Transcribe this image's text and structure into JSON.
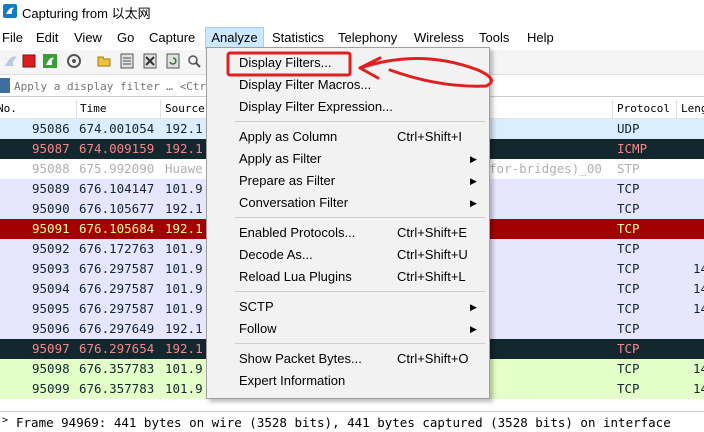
{
  "window": {
    "title": "Capturing from 以太网"
  },
  "menubar": {
    "items": [
      "File",
      "Edit",
      "View",
      "Go",
      "Capture",
      "Analyze",
      "Statistics",
      "Telephony",
      "Wireless",
      "Tools",
      "Help"
    ]
  },
  "filter": {
    "placeholder": "Apply a display filter … <Ctrl-/>"
  },
  "columns": {
    "no": "No.",
    "time": "Time",
    "source": "Source",
    "protocol": "Protocol",
    "length": "Length"
  },
  "packets": [
    {
      "no": "95086",
      "time": "674.001054",
      "src": "192.1",
      "proto": "UDP",
      "len": "",
      "bg": "#daeeff",
      "fg": "#12272e"
    },
    {
      "no": "95087",
      "time": "674.009159",
      "src": "192.1",
      "proto": "ICMP",
      "len": "",
      "bg": "#12272e",
      "fg": "#f78787"
    },
    {
      "no": "95088",
      "time": "675.992090",
      "src": "Huawe",
      "extra": "for-bridges)_00",
      "proto": "STP",
      "len": "",
      "bg": "#ffffff",
      "fg": "#b0b0b0"
    },
    {
      "no": "95089",
      "time": "676.104147",
      "src": "101.9",
      "proto": "TCP",
      "len": "",
      "bg": "#e7e6ff",
      "fg": "#12272e"
    },
    {
      "no": "95090",
      "time": "676.105677",
      "src": "192.1",
      "proto": "TCP",
      "len": "",
      "bg": "#e7e6ff",
      "fg": "#12272e"
    },
    {
      "no": "95091",
      "time": "676.105684",
      "src": "192.1",
      "proto": "TCP",
      "len": "",
      "bg": "#a40000",
      "fg": "#fffc9c"
    },
    {
      "no": "95092",
      "time": "676.172763",
      "src": "101.9",
      "proto": "TCP",
      "len": "",
      "bg": "#e7e6ff",
      "fg": "#12272e"
    },
    {
      "no": "95093",
      "time": "676.297587",
      "src": "101.9",
      "proto": "TCP",
      "len": "14",
      "bg": "#e7e6ff",
      "fg": "#12272e"
    },
    {
      "no": "95094",
      "time": "676.297587",
      "src": "101.9",
      "proto": "TCP",
      "len": "14",
      "bg": "#e7e6ff",
      "fg": "#12272e"
    },
    {
      "no": "95095",
      "time": "676.297587",
      "src": "101.9",
      "proto": "TCP",
      "len": "14",
      "bg": "#e7e6ff",
      "fg": "#12272e"
    },
    {
      "no": "95096",
      "time": "676.297649",
      "src": "192.1",
      "proto": "TCP",
      "len": "",
      "bg": "#e7e6ff",
      "fg": "#12272e"
    },
    {
      "no": "95097",
      "time": "676.297654",
      "src": "192.1",
      "proto": "TCP",
      "len": "",
      "bg": "#12272e",
      "fg": "#f78787"
    },
    {
      "no": "95098",
      "time": "676.357783",
      "src": "101.9",
      "proto": "TCP",
      "len": "14",
      "bg": "#e4ffc7",
      "fg": "#12272e"
    },
    {
      "no": "95099",
      "time": "676.357783",
      "src": "101.9",
      "proto": "TCP",
      "len": "14",
      "bg": "#e4ffc7",
      "fg": "#12272e"
    }
  ],
  "statusbar": {
    "text": "Frame 94969: 441 bytes on wire (3528 bits), 441 bytes captured (3528 bits) on interface"
  },
  "analyze_menu": {
    "items": [
      {
        "label": "Display Filters...",
        "shortcut": "",
        "submenu": false
      },
      {
        "label": "Display Filter Macros...",
        "shortcut": "",
        "submenu": false
      },
      {
        "label": "Display Filter Expression...",
        "shortcut": "",
        "submenu": false
      },
      {
        "sep": true
      },
      {
        "label": "Apply as Column",
        "shortcut": "Ctrl+Shift+I",
        "submenu": false
      },
      {
        "label": "Apply as Filter",
        "shortcut": "",
        "submenu": true
      },
      {
        "label": "Prepare as Filter",
        "shortcut": "",
        "submenu": true
      },
      {
        "label": "Conversation Filter",
        "shortcut": "",
        "submenu": true
      },
      {
        "sep": true
      },
      {
        "label": "Enabled Protocols...",
        "shortcut": "Ctrl+Shift+E",
        "submenu": false
      },
      {
        "label": "Decode As...",
        "shortcut": "Ctrl+Shift+U",
        "submenu": false
      },
      {
        "label": "Reload Lua Plugins",
        "shortcut": "Ctrl+Shift+L",
        "submenu": false
      },
      {
        "sep": true
      },
      {
        "label": "SCTP",
        "shortcut": "",
        "submenu": true
      },
      {
        "label": "Follow",
        "shortcut": "",
        "submenu": true
      },
      {
        "sep": true
      },
      {
        "label": "Show Packet Bytes...",
        "shortcut": "Ctrl+Shift+O",
        "submenu": false
      },
      {
        "label": "Expert Information",
        "shortcut": "",
        "submenu": false
      }
    ]
  },
  "colors": {
    "menu_active": "#cce8ff",
    "annotation": "#e02020",
    "filter_bookmark": "#3c6ea3"
  },
  "icons": [
    "wireshark-fin-icon",
    "start-capture-icon",
    "stop-capture-icon",
    "restart-capture-icon",
    "capture-options-icon",
    "open-file-icon",
    "save-file-icon",
    "close-file-icon",
    "reload-file-icon",
    "find-packet-icon"
  ]
}
